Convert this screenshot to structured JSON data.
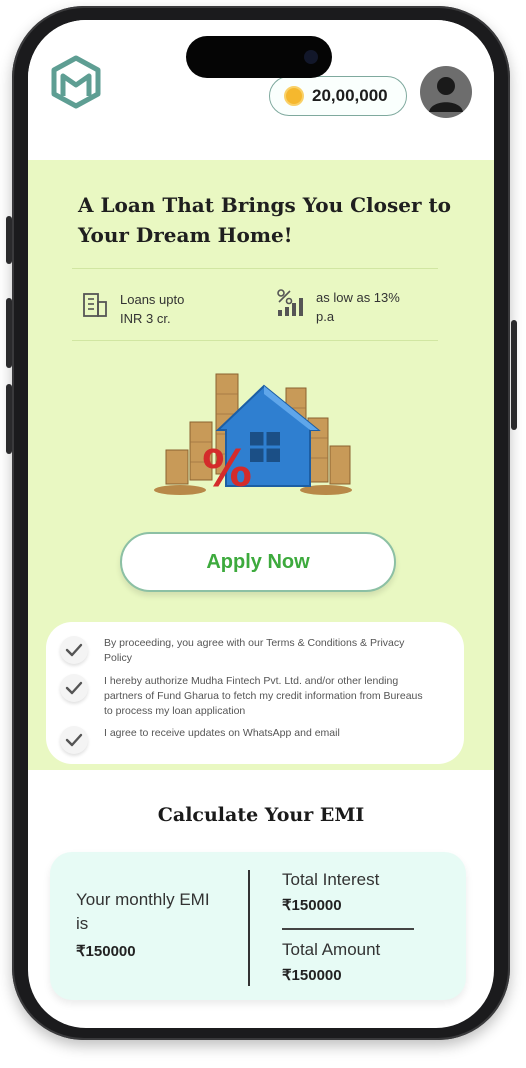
{
  "header": {
    "coin_balance": "20,00,000",
    "logo_icon": "brand-logo-icon",
    "avatar_icon": "user-avatar-icon"
  },
  "hero": {
    "title": "A Loan That Brings You Closer to Your Dream Home!",
    "features": [
      {
        "icon": "building-icon",
        "line1": "Loans upto",
        "line2": "INR 3 cr."
      },
      {
        "icon": "rate-chart-icon",
        "line1": "as low as  13%",
        "line2": "p.a"
      }
    ],
    "illustration": "house-coins-illustration"
  },
  "apply_button": "Apply Now",
  "consents": [
    {
      "text": "By proceeding, you agree with our Terms & Conditions & Privacy Policy"
    },
    {
      "text": "I hereby authorize Mudha Fintech Pvt. Ltd. and/or other lending partners of Fund Gharua to fetch my credit information from Bureaus to process my loan application"
    },
    {
      "text": "I agree to receive updates on WhatsApp and email"
    }
  ],
  "emi": {
    "title": "Calculate Your EMI",
    "monthly_label": "Your monthly EMI is",
    "monthly_value": "₹150000",
    "interest_label": "Total Interest",
    "interest_value": "₹150000",
    "amount_label": "Total Amount",
    "amount_value": "₹150000"
  },
  "colors": {
    "hero_bg": "#e9f8c2",
    "accent_green": "#3daa3d",
    "emi_card_bg": "#e7fbf5",
    "brand_teal": "#5e9e93"
  }
}
